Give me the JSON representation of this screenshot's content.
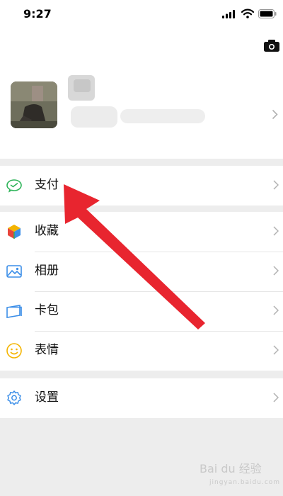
{
  "status_bar": {
    "time": "9:27"
  },
  "menu": [
    {
      "label": "支付",
      "icon": "pay-icon"
    },
    {
      "label": "收藏",
      "icon": "favorites-icon"
    },
    {
      "label": "相册",
      "icon": "album-icon"
    },
    {
      "label": "卡包",
      "icon": "card-wallet-icon"
    },
    {
      "label": "表情",
      "icon": "sticker-icon"
    },
    {
      "label": "设置",
      "icon": "settings-icon"
    }
  ],
  "watermark": {
    "text": "Bai du 经验",
    "subtext": "jingyan.baidu.com"
  },
  "colors": {
    "accent": "#e8252f",
    "pay": "#2fb45a",
    "background": "#ededed"
  }
}
